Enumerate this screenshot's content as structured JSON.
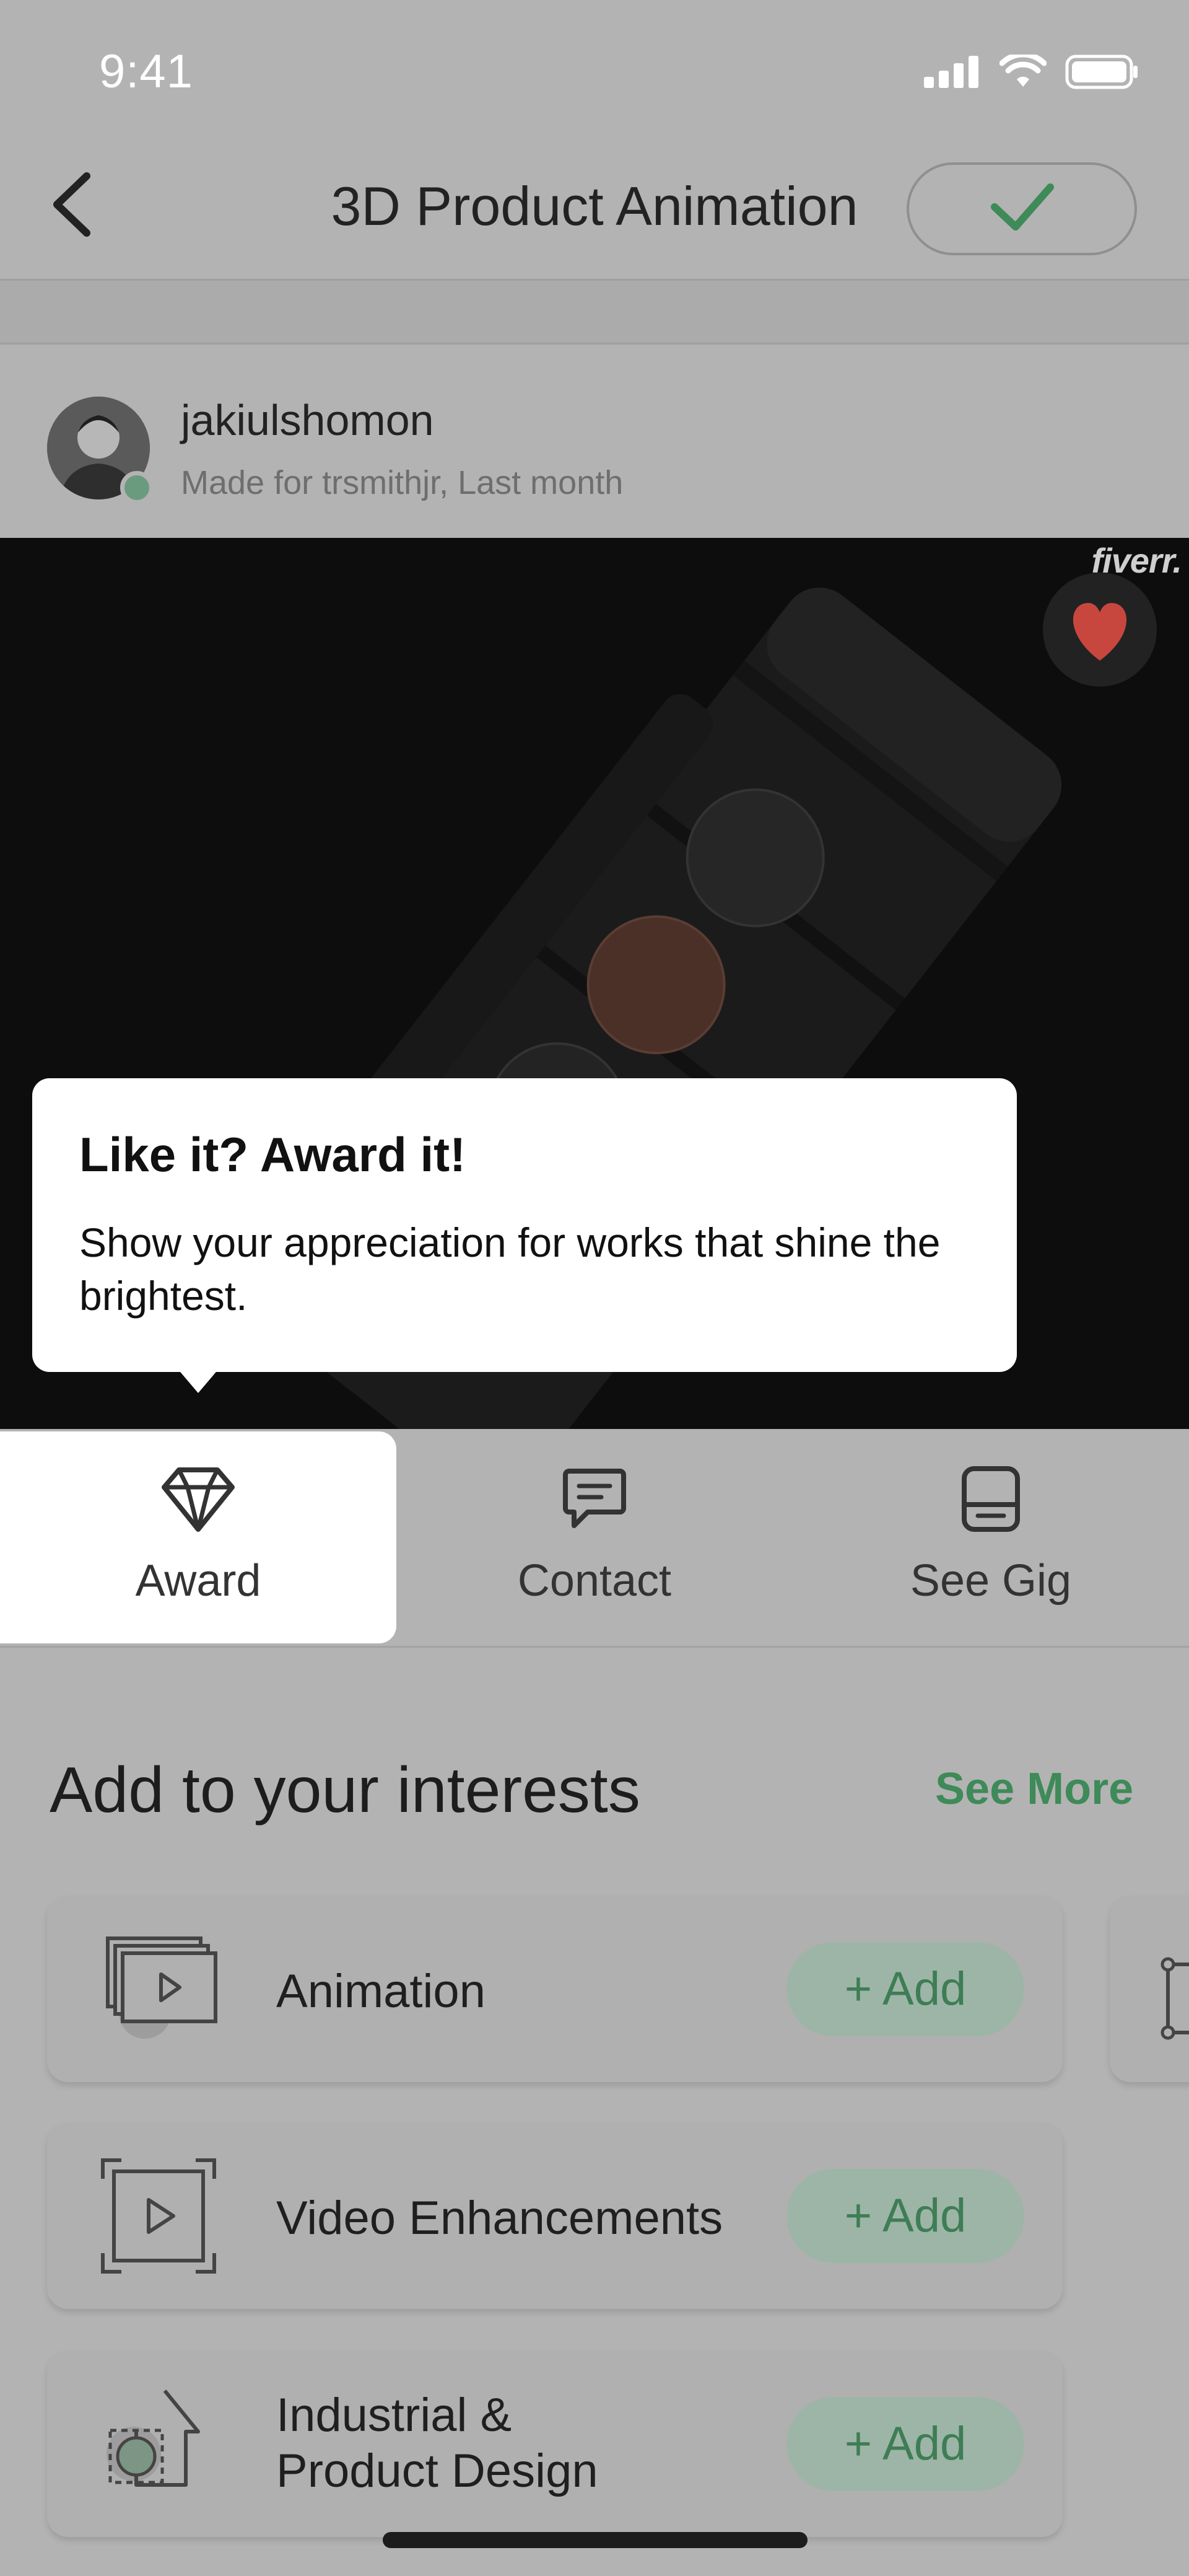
{
  "status_bar": {
    "time": "9:41"
  },
  "header": {
    "title": "3D Product Animation"
  },
  "author": {
    "name": "jakiulshomon",
    "subtitle": "Made for trsmithjr, Last month"
  },
  "media": {
    "watermark": "fiverr."
  },
  "tooltip": {
    "title": "Like it? Award it!",
    "body": "Show your appreciation for works that shine the brightest."
  },
  "actions": [
    {
      "label": "Award",
      "icon": "diamond-icon"
    },
    {
      "label": "Contact",
      "icon": "chat-icon"
    },
    {
      "label": "See Gig",
      "icon": "gig-icon"
    }
  ],
  "interests": {
    "title": "Add to your interests",
    "see_more": "See More",
    "items": [
      {
        "label": "Animation",
        "add": "Add",
        "icon": "animation-icon"
      },
      {
        "label": "Video Enhancements",
        "add": "Add",
        "icon": "video-frame-icon"
      },
      {
        "label_line1": "Industrial &",
        "label_line2": "Product Design",
        "add": "Add",
        "icon": "product-design-icon"
      }
    ]
  },
  "colors": {
    "accent": "#3e8a58",
    "heart": "#c7473f",
    "overlay": "#b3b3b3"
  }
}
